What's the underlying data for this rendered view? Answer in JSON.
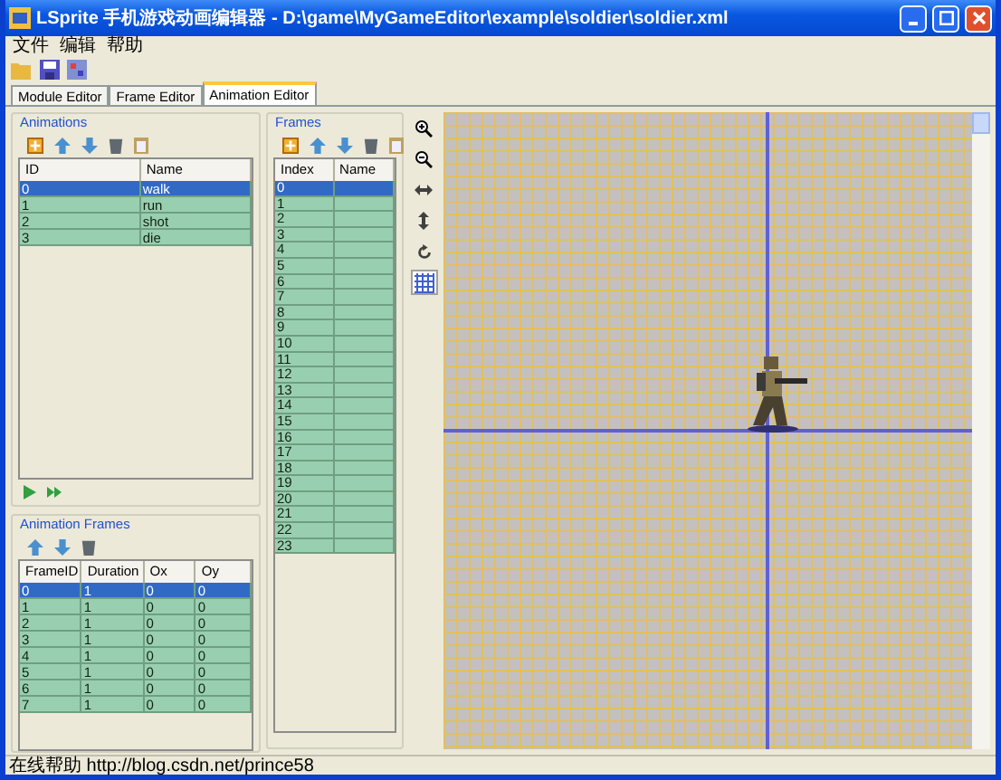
{
  "window": {
    "app_name": "LSprite",
    "title": "手机游戏动画编辑器",
    "path": "- D:\\game\\MyGameEditor\\example\\soldier\\soldier.xml"
  },
  "menu": [
    "文件",
    "编辑",
    "帮助"
  ],
  "tabs": [
    {
      "label": "Module Editor",
      "selected": false
    },
    {
      "label": "Frame Editor",
      "selected": false
    },
    {
      "label": "Animation Editor",
      "selected": true
    }
  ],
  "animations": {
    "title": "Animations",
    "columns": [
      "ID",
      "Name"
    ],
    "rows": [
      {
        "cells": [
          "0",
          "walk"
        ],
        "selected": true
      },
      {
        "cells": [
          "1",
          "run"
        ],
        "selected": false
      },
      {
        "cells": [
          "2",
          "shot"
        ],
        "selected": false
      },
      {
        "cells": [
          "3",
          "die"
        ],
        "selected": false
      }
    ]
  },
  "animation_frames": {
    "title": "Animation Frames",
    "columns": [
      "FrameID",
      "Duration",
      "Ox",
      "Oy"
    ],
    "rows": [
      {
        "cells": [
          "0",
          "1",
          "0",
          "0"
        ],
        "selected": true
      },
      {
        "cells": [
          "1",
          "1",
          "0",
          "0"
        ],
        "selected": false
      },
      {
        "cells": [
          "2",
          "1",
          "0",
          "0"
        ],
        "selected": false
      },
      {
        "cells": [
          "3",
          "1",
          "0",
          "0"
        ],
        "selected": false
      },
      {
        "cells": [
          "4",
          "1",
          "0",
          "0"
        ],
        "selected": false
      },
      {
        "cells": [
          "5",
          "1",
          "0",
          "0"
        ],
        "selected": false
      },
      {
        "cells": [
          "6",
          "1",
          "0",
          "0"
        ],
        "selected": false
      },
      {
        "cells": [
          "7",
          "1",
          "0",
          "0"
        ],
        "selected": false
      }
    ]
  },
  "frames": {
    "title": "Frames",
    "columns": [
      "Index",
      "Name"
    ],
    "rows": [
      {
        "cells": [
          "0",
          ""
        ],
        "selected": true
      },
      {
        "cells": [
          "1",
          ""
        ],
        "selected": false
      },
      {
        "cells": [
          "2",
          ""
        ],
        "selected": false
      },
      {
        "cells": [
          "3",
          ""
        ],
        "selected": false
      },
      {
        "cells": [
          "4",
          ""
        ],
        "selected": false
      },
      {
        "cells": [
          "5",
          ""
        ],
        "selected": false
      },
      {
        "cells": [
          "6",
          ""
        ],
        "selected": false
      },
      {
        "cells": [
          "7",
          ""
        ],
        "selected": false
      },
      {
        "cells": [
          "8",
          ""
        ],
        "selected": false
      },
      {
        "cells": [
          "9",
          ""
        ],
        "selected": false
      },
      {
        "cells": [
          "10",
          ""
        ],
        "selected": false
      },
      {
        "cells": [
          "11",
          ""
        ],
        "selected": false
      },
      {
        "cells": [
          "12",
          ""
        ],
        "selected": false
      },
      {
        "cells": [
          "13",
          ""
        ],
        "selected": false
      },
      {
        "cells": [
          "14",
          ""
        ],
        "selected": false
      },
      {
        "cells": [
          "15",
          ""
        ],
        "selected": false
      },
      {
        "cells": [
          "16",
          ""
        ],
        "selected": false
      },
      {
        "cells": [
          "17",
          ""
        ],
        "selected": false
      },
      {
        "cells": [
          "18",
          ""
        ],
        "selected": false
      },
      {
        "cells": [
          "19",
          ""
        ],
        "selected": false
      },
      {
        "cells": [
          "20",
          ""
        ],
        "selected": false
      },
      {
        "cells": [
          "21",
          ""
        ],
        "selected": false
      },
      {
        "cells": [
          "22",
          ""
        ],
        "selected": false
      },
      {
        "cells": [
          "23",
          ""
        ],
        "selected": false
      }
    ]
  },
  "canvas_tools": [
    {
      "kind": "zoom-in",
      "selected": false
    },
    {
      "kind": "zoom-out",
      "selected": false
    },
    {
      "kind": "flip-h",
      "selected": false
    },
    {
      "kind": "flip-v",
      "selected": false
    },
    {
      "kind": "rotate",
      "selected": false
    },
    {
      "kind": "grid",
      "selected": true
    }
  ],
  "status_bar": "在线帮助 http://blog.csdn.net/prince58"
}
